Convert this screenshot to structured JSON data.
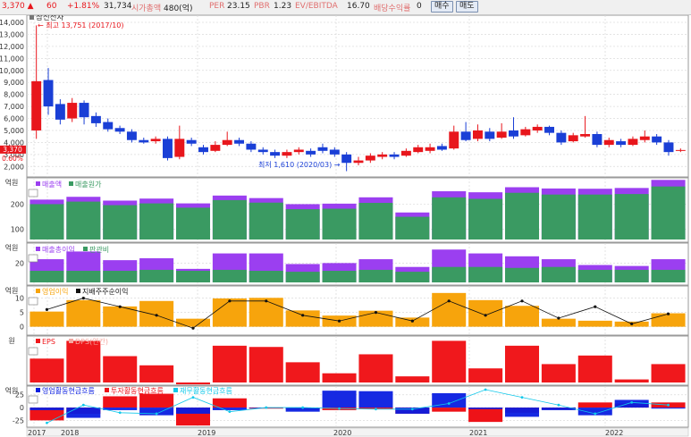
{
  "header": {
    "price": "3,370",
    "change_arrow": "▲",
    "change": "60",
    "change_pct": "+1.81%",
    "volume": "31,734",
    "market_cap_label": "시가총액",
    "market_cap": "480(억)",
    "per_label": "PER",
    "per": "23.15",
    "pbr_label": "PBR",
    "pbr": "1.23",
    "ev_label": "EV/EBITDA",
    "ev": "16.70",
    "div_label": "배당수익률",
    "div": "0",
    "buy_label": "매수",
    "sell_label": "매도"
  },
  "colors": {
    "up": "#e8161c",
    "down": "#1a3fd6",
    "sales": "#3a9a62",
    "cost_top": "#9b3ff0",
    "op_profit": "#f7a40c",
    "net_line": "#111111",
    "eps": "#f0181c",
    "cf_op": "#0a1ee0",
    "cf_inv": "#ee1218",
    "cf_fin": "#11c8ea"
  },
  "chart_data": [
    {
      "type": "candlestick",
      "legend": [
        "삼신전자"
      ],
      "ylim": [
        1500,
        14300
      ],
      "yticks": [
        "14,000",
        "13,000",
        "12,000",
        "11,000",
        "10,000",
        "9,000",
        "8,000",
        "7,000",
        "6,000",
        "5,000",
        "4,000",
        "3,000",
        "2,000"
      ],
      "current_price_label": "3,370",
      "current_pct_label": "0.60%",
      "annotation_high": "← 최고 13,751 (2017/10)",
      "annotation_low": "최저 1,610 (2020/03) →",
      "candles": [
        {
          "o": 5000,
          "c": 9100,
          "h": 13750,
          "l": 4300
        },
        {
          "o": 9200,
          "c": 7000,
          "h": 10200,
          "l": 6300
        },
        {
          "o": 7200,
          "c": 5900,
          "h": 7600,
          "l": 5500
        },
        {
          "o": 6000,
          "c": 7300,
          "h": 7700,
          "l": 5700
        },
        {
          "o": 7300,
          "c": 6100,
          "h": 7500,
          "l": 5500
        },
        {
          "o": 6200,
          "c": 5600,
          "h": 6500,
          "l": 5300
        },
        {
          "o": 5700,
          "c": 5100,
          "h": 6000,
          "l": 4900
        },
        {
          "o": 5200,
          "c": 4900,
          "h": 5400,
          "l": 4700
        },
        {
          "o": 4900,
          "c": 4200,
          "h": 5100,
          "l": 4000
        },
        {
          "o": 4200,
          "c": 4000,
          "h": 4400,
          "l": 3900
        },
        {
          "o": 4100,
          "c": 4300,
          "h": 4500,
          "l": 3900
        },
        {
          "o": 4300,
          "c": 2700,
          "h": 4500,
          "l": 2500
        },
        {
          "o": 2800,
          "c": 4300,
          "h": 5400,
          "l": 2600
        },
        {
          "o": 4200,
          "c": 3900,
          "h": 4400,
          "l": 3700
        },
        {
          "o": 3600,
          "c": 3200,
          "h": 3800,
          "l": 3000
        },
        {
          "o": 3300,
          "c": 3800,
          "h": 4100,
          "l": 3200
        },
        {
          "o": 3800,
          "c": 4200,
          "h": 4900,
          "l": 3700
        },
        {
          "o": 4200,
          "c": 3900,
          "h": 4400,
          "l": 3700
        },
        {
          "o": 3900,
          "c": 3400,
          "h": 4100,
          "l": 3200
        },
        {
          "o": 3400,
          "c": 3200,
          "h": 3600,
          "l": 3000
        },
        {
          "o": 3200,
          "c": 2900,
          "h": 3400,
          "l": 2700
        },
        {
          "o": 2900,
          "c": 3200,
          "h": 3400,
          "l": 2700
        },
        {
          "o": 3200,
          "c": 3400,
          "h": 3600,
          "l": 3000
        },
        {
          "o": 3300,
          "c": 3000,
          "h": 3500,
          "l": 2800
        },
        {
          "o": 3600,
          "c": 3300,
          "h": 3900,
          "l": 3100
        },
        {
          "o": 3400,
          "c": 3000,
          "h": 3600,
          "l": 2800
        },
        {
          "o": 3000,
          "c": 2300,
          "h": 3200,
          "l": 1610
        },
        {
          "o": 2300,
          "c": 2500,
          "h": 2800,
          "l": 2100
        },
        {
          "o": 2500,
          "c": 2900,
          "h": 3100,
          "l": 2300
        },
        {
          "o": 2800,
          "c": 3000,
          "h": 3200,
          "l": 2600
        },
        {
          "o": 3000,
          "c": 2800,
          "h": 3200,
          "l": 2600
        },
        {
          "o": 2900,
          "c": 3300,
          "h": 3500,
          "l": 2800
        },
        {
          "o": 3200,
          "c": 3600,
          "h": 3800,
          "l": 3100
        },
        {
          "o": 3300,
          "c": 3600,
          "h": 3900,
          "l": 3100
        },
        {
          "o": 3700,
          "c": 3400,
          "h": 3900,
          "l": 3300
        },
        {
          "o": 3500,
          "c": 4900,
          "h": 5400,
          "l": 3400
        },
        {
          "o": 4900,
          "c": 4200,
          "h": 5700,
          "l": 4100
        },
        {
          "o": 4300,
          "c": 5000,
          "h": 5500,
          "l": 4100
        },
        {
          "o": 4900,
          "c": 4300,
          "h": 5200,
          "l": 4100
        },
        {
          "o": 4400,
          "c": 4900,
          "h": 5600,
          "l": 4300
        },
        {
          "o": 5000,
          "c": 4500,
          "h": 6100,
          "l": 4300
        },
        {
          "o": 4600,
          "c": 5100,
          "h": 5300,
          "l": 4500
        },
        {
          "o": 5000,
          "c": 5300,
          "h": 5500,
          "l": 4800
        },
        {
          "o": 5300,
          "c": 4800,
          "h": 5400,
          "l": 4600
        },
        {
          "o": 4800,
          "c": 4000,
          "h": 5000,
          "l": 3800
        },
        {
          "o": 4100,
          "c": 4600,
          "h": 4800,
          "l": 4000
        },
        {
          "o": 4500,
          "c": 4700,
          "h": 6200,
          "l": 4400
        },
        {
          "o": 4700,
          "c": 3800,
          "h": 4900,
          "l": 3600
        },
        {
          "o": 3800,
          "c": 4200,
          "h": 4400,
          "l": 3600
        },
        {
          "o": 4100,
          "c": 3800,
          "h": 4300,
          "l": 3600
        },
        {
          "o": 3800,
          "c": 4300,
          "h": 4500,
          "l": 3700
        },
        {
          "o": 4200,
          "c": 4500,
          "h": 5000,
          "l": 4000
        },
        {
          "o": 4500,
          "c": 4000,
          "h": 4700,
          "l": 3800
        },
        {
          "o": 4000,
          "c": 3200,
          "h": 4200,
          "l": 2900
        },
        {
          "o": 3300,
          "c": 3370,
          "h": 3500,
          "l": 3200
        }
      ]
    },
    {
      "type": "bar",
      "unit": "억원",
      "legend": [
        "매출액",
        "매출원가"
      ],
      "yticks": [
        200,
        100
      ],
      "ylim": [
        60,
        290
      ],
      "series": [
        {
          "values": [
            218,
            229,
            214,
            222,
            203,
            234,
            224,
            200,
            202,
            227,
            167,
            251,
            247,
            267,
            262,
            261,
            264,
            296
          ]
        },
        {
          "values": [
            200,
            210,
            196,
            203,
            186,
            216,
            206,
            180,
            182,
            205,
            150,
            227,
            221,
            245,
            238,
            238,
            240,
            270
          ]
        }
      ]
    },
    {
      "type": "bar",
      "unit": "억원",
      "legend": [
        "매출총이익",
        "판관비"
      ],
      "yticks": [
        20
      ],
      "ylim": [
        0,
        37
      ],
      "series": [
        {
          "values": [
            24,
            32,
            23,
            25,
            14,
            30,
            30,
            19,
            20,
            24,
            16,
            34,
            30,
            27,
            24,
            18,
            17,
            24
          ]
        },
        {
          "values": [
            12,
            12,
            12,
            13,
            12,
            13,
            12,
            11,
            12,
            13,
            11,
            16,
            16,
            15,
            16,
            13,
            13,
            13
          ]
        }
      ]
    },
    {
      "type": "bar+line",
      "unit": "억원",
      "legend": [
        "영업이익",
        "지배주주순이익"
      ],
      "yticks": [
        10,
        5,
        0
      ],
      "ylim": [
        -2,
        13
      ],
      "series": [
        {
          "values": [
            5.3,
            9.3,
            7.1,
            9.0,
            2.8,
            9.9,
            10.1,
            5.7,
            3.9,
            5.6,
            3.2,
            11.8,
            9.3,
            7.3,
            2.8,
            2.1,
            1.8,
            4.7
          ]
        },
        {
          "values": [
            6.0,
            10.0,
            7.0,
            4.0,
            -0.5,
            9.0,
            9.0,
            4.0,
            2.0,
            5.0,
            2.0,
            9.0,
            4.0,
            9.0,
            3.0,
            7.0,
            1.0,
            4.5
          ]
        }
      ]
    },
    {
      "type": "bar",
      "unit": "원",
      "legend": [
        "EPS",
        "DPS(연간)"
      ],
      "ylim": [
        0,
        70
      ],
      "series": [
        {
          "values": [
            39,
            68,
            43,
            28,
            -3,
            60,
            58,
            33,
            15,
            46,
            10,
            68,
            23,
            60,
            30,
            44,
            5,
            30
          ]
        },
        {
          "values": [
            0,
            0,
            0,
            0,
            0,
            0,
            0,
            0,
            0,
            0,
            0,
            0,
            0,
            0,
            0,
            0,
            0,
            0
          ]
        }
      ]
    },
    {
      "type": "bar+line",
      "unit": "억원",
      "legend": [
        "영업활동현금흐름",
        "투자활동현금흐름",
        "재무활동현금흐름"
      ],
      "yticks": [
        25,
        0,
        -25
      ],
      "ylim": [
        -33,
        35
      ],
      "series": [
        {
          "values": [
            -5,
            -20,
            -5,
            -15,
            -12,
            -5,
            -1,
            -8,
            33,
            32,
            -12,
            28,
            -3,
            -18,
            -5,
            -15,
            15,
            -2
          ]
        },
        {
          "values": [
            -25,
            -12,
            22,
            27,
            -35,
            18,
            -2,
            -3,
            -5,
            -3,
            -12,
            -8,
            -28,
            -10,
            -4,
            10,
            8,
            10
          ]
        },
        {
          "values": [
            -30,
            5,
            -10,
            -12,
            20,
            -8,
            0,
            0,
            -2,
            -3,
            -3,
            8,
            35,
            20,
            5,
            -12,
            10,
            5
          ]
        }
      ]
    }
  ],
  "x_axis": {
    "labels": [
      "2017",
      "2018",
      "2019",
      "2020",
      "2021",
      "2022"
    ],
    "quarter_positions": [
      0,
      2,
      6,
      10,
      14,
      18
    ]
  }
}
